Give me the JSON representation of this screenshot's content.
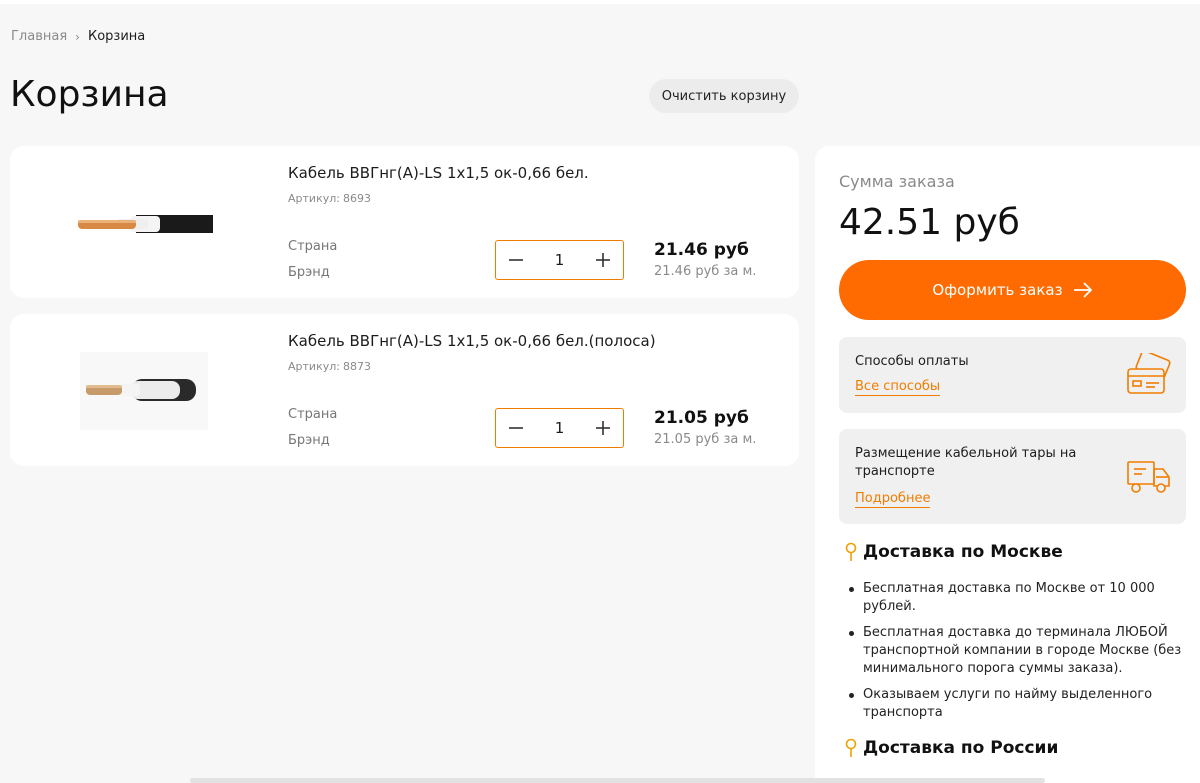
{
  "breadcrumb": {
    "home": "Главная",
    "current": "Корзина"
  },
  "page": {
    "title": "Корзина",
    "clear_button": "Очистить корзину"
  },
  "items": [
    {
      "name": "Кабель ВВГнг(А)-LS 1х1,5 ок-0,66 бел.",
      "sku_label": "Артикул:",
      "sku": "8693",
      "country_label": "Страна",
      "brand_label": "Брэнд",
      "quantity": "1",
      "price": "21.46 руб",
      "unit_price": "21.46 руб за м."
    },
    {
      "name": "Кабель ВВГнг(А)-LS 1х1,5 ок-0,66 бел.(полоса)",
      "sku_label": "Артикул:",
      "sku": "8873",
      "country_label": "Страна",
      "brand_label": "Брэнд",
      "quantity": "1",
      "price": "21.05 руб",
      "unit_price": "21.05 руб за м."
    }
  ],
  "summary": {
    "label": "Сумма заказа",
    "total": "42.51 руб",
    "checkout_button": "Оформить заказ",
    "payment": {
      "title": "Способы оплаты",
      "link": "Все способы"
    },
    "cable": {
      "title": "Размещение кабельной тары на транспорте",
      "link": "Подробнее"
    },
    "delivery_moscow": {
      "title": "Доставка по Москве",
      "items": [
        "Бесплатная доставка по Москве от 10 000 рублей.",
        "Бесплатная доставка до терминала ЛЮБОЙ транспортной компании в городе Москве (без минимального порога суммы заказа).",
        "Оказываем услуги по найму выделенного транспорта"
      ]
    },
    "delivery_russia": {
      "title": "Доставка по России"
    }
  },
  "colors": {
    "accent": "#ff6b00",
    "accent_text": "#f07d00",
    "background": "#f7f7f7",
    "card": "#ffffff"
  }
}
